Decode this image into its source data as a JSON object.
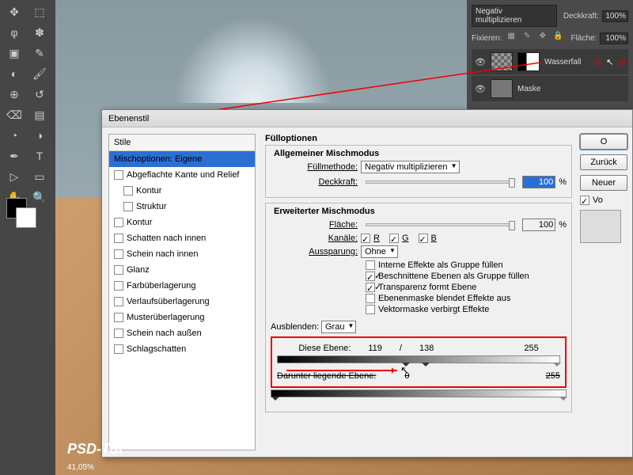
{
  "toolbar": {
    "tools": [
      "▭",
      "▦",
      "⬚",
      "✥",
      "◐",
      "↔",
      "φ",
      "✎",
      "✽",
      "⌫",
      "▤",
      "≡",
      "◔",
      "⟋",
      "◧",
      "⬕",
      "✋",
      "T",
      "◑",
      "▢",
      "⤧",
      "⊕",
      "✜",
      "🔍"
    ]
  },
  "panel": {
    "blend": "Negativ multiplizieren",
    "opacity_lbl": "Deckkraft:",
    "opacity": "100%",
    "lock_lbl": "Fixieren:",
    "fill_lbl": "Fläche:",
    "fill": "100%",
    "layer1": "Wasserfall",
    "layer2": "Maske",
    "anno_l": "((",
    "anno_r": "))"
  },
  "dialog": {
    "title": "Ebenenstil",
    "styles_header": "Stile",
    "styles": [
      {
        "label": "Mischoptionen: Eigene",
        "sel": true
      },
      {
        "label": "Abgeflachte Kante und Relief",
        "cb": true
      },
      {
        "label": "Kontur",
        "cb": true,
        "sub": true
      },
      {
        "label": "Struktur",
        "cb": true,
        "sub": true
      },
      {
        "label": "Kontur",
        "cb": true
      },
      {
        "label": "Schatten nach innen",
        "cb": true
      },
      {
        "label": "Schein nach innen",
        "cb": true
      },
      {
        "label": "Glanz",
        "cb": true
      },
      {
        "label": "Farbüberlagerung",
        "cb": true
      },
      {
        "label": "Verlaufsüberlagerung",
        "cb": true
      },
      {
        "label": "Musterüberlagerung",
        "cb": true
      },
      {
        "label": "Schein nach außen",
        "cb": true
      },
      {
        "label": "Schlagschatten",
        "cb": true
      }
    ],
    "fill_title": "Fülloptionen",
    "general": "Allgemeiner Mischmodus",
    "fill_method_lbl": "Füllmethode:",
    "fill_method": "Negativ multiplizieren",
    "opacity_lbl": "Deckkraft:",
    "opacity": "100",
    "pct": "%",
    "adv": "Erweiterter Mischmodus",
    "area_lbl": "Fläche:",
    "area": "100",
    "channels_lbl": "Kanäle:",
    "ch_r": "R",
    "ch_g": "G",
    "ch_b": "B",
    "knock_lbl": "Aussparung:",
    "knock": "Ohne",
    "o1": "Interne Effekte als Gruppe füllen",
    "o2": "Beschnittene Ebenen als Gruppe füllen",
    "o3": "Transparenz formt Ebene",
    "o4": "Ebenenmaske blendet Effekte aus",
    "o5": "Vektormaske verbirgt Effekte",
    "blendif_lbl": "Ausblenden:",
    "blendif": "Grau",
    "this_lbl": "Diese Ebene:",
    "this_a": "119",
    "this_sep": "/",
    "this_b": "138",
    "this_c": "255",
    "under_lbl": "Darunter liegende Ebene:",
    "under_a": "0",
    "under_b": "255",
    "btn_ok": "O",
    "btn_cancel": "Zurück",
    "btn_new": "Neuer",
    "cb_preview": "Vo"
  },
  "footer": {
    "brand": "PSD-Tut",
    "zoom": "41,05%"
  }
}
